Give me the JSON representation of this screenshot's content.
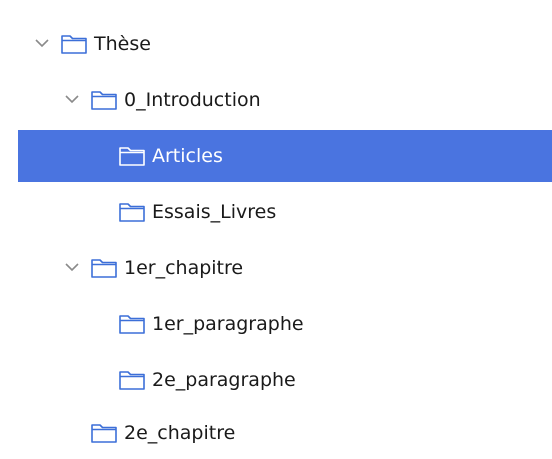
{
  "tree": {
    "items": [
      {
        "label": "Thèse",
        "expanded": true,
        "icon": "folder-icon"
      },
      {
        "label": "0_Introduction",
        "expanded": true,
        "icon": "folder-icon"
      },
      {
        "label": "Articles",
        "selected": true,
        "icon": "folder-icon"
      },
      {
        "label": "Essais_Livres",
        "icon": "folder-icon"
      },
      {
        "label": "1er_chapitre",
        "expanded": true,
        "icon": "folder-icon"
      },
      {
        "label": "1er_paragraphe",
        "icon": "folder-icon"
      },
      {
        "label": "2e_paragraphe",
        "icon": "folder-icon"
      },
      {
        "label": "2e_chapitre",
        "icon": "folder-icon"
      }
    ]
  },
  "colors": {
    "selection": "#4a74e0",
    "folder_outline": "#3c6fd8",
    "folder_outline_selected": "#ffffff",
    "chevron": "#8a8a8a",
    "text": "#1a1a1a"
  }
}
